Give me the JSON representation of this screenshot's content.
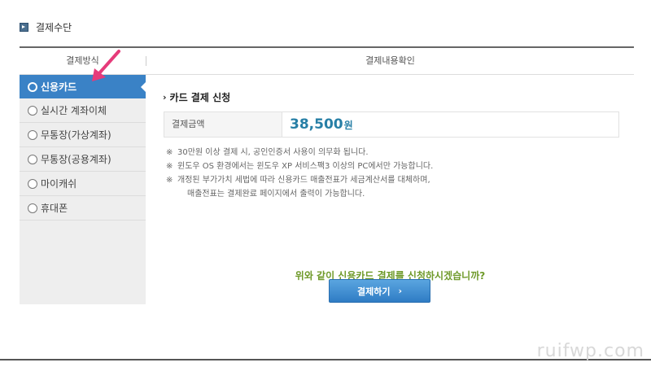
{
  "section": {
    "title": "결제수단"
  },
  "header": {
    "left": "결제방식",
    "right": "결제내용확인"
  },
  "methods": [
    {
      "label": "신용카드"
    },
    {
      "label": "실시간 계좌이체"
    },
    {
      "label": "무통장(가상계좌)"
    },
    {
      "label": "무통장(공용계좌)"
    },
    {
      "label": "마이캐쉬"
    },
    {
      "label": "휴대폰"
    }
  ],
  "selected_method": "신용카드",
  "apply": {
    "title": "카드 결제 신청"
  },
  "amount": {
    "label": "결제금액",
    "value": "38,500",
    "unit": "원"
  },
  "notes": [
    {
      "mark": "※",
      "text": "30만원 이상 결제 시, 공인인증서 사용이 의무화 됩니다."
    },
    {
      "mark": "※",
      "text": "윈도우 OS 환경에서는 윈도우 XP 서비스팩3 이상의 PC에서만 가능합니다."
    },
    {
      "mark": "※",
      "text": "개정된 부가가치 세법에 따라 신용카드 매출전표가 세금계산서를 대체하며,"
    },
    {
      "mark": "",
      "text": "매출전표는 결제완료 페이지에서 출력이 가능합니다."
    }
  ],
  "question": "위와 같이 신용카드 결제를 신청하시겠습니까?",
  "pay_button": {
    "label": "결제하기"
  },
  "watermark": "ruifwp.com",
  "colors": {
    "accent": "#3a82c6",
    "amount": "#277fa6",
    "question": "#6f9a2a",
    "pointer": "#e63b7a"
  }
}
